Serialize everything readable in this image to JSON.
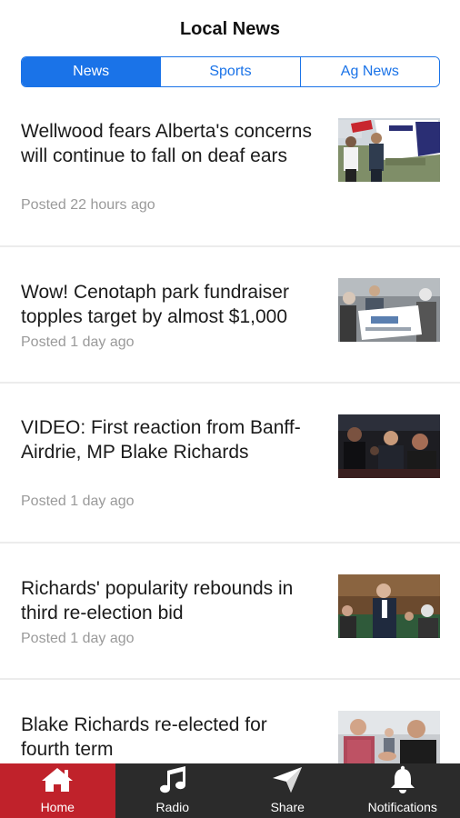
{
  "header": {
    "title": "Local News"
  },
  "tabs": [
    {
      "label": "News",
      "active": true
    },
    {
      "label": "Sports",
      "active": false
    },
    {
      "label": "Ag News",
      "active": false
    }
  ],
  "articles": [
    {
      "title": "Wellwood fears Alberta's concerns will continue to fall on deaf ears",
      "meta": "Posted 22 hours ago"
    },
    {
      "title": "Wow! Cenotaph park fundraiser topples target by almost $1,000",
      "meta": "Posted 1 day ago"
    },
    {
      "title": "VIDEO: First reaction from Banff- Airdrie, MP Blake Richards",
      "meta": "Posted 1 day ago"
    },
    {
      "title": "Richards' popularity rebounds in third re-election bid",
      "meta": "Posted 1 day ago"
    },
    {
      "title": "Blake Richards re-elected for fourth term",
      "meta": ""
    }
  ],
  "tabbar": [
    {
      "label": "Home",
      "icon": "home-icon",
      "active": true
    },
    {
      "label": "Radio",
      "icon": "music-note-icon",
      "active": false
    },
    {
      "label": "Share",
      "icon": "paper-plane-icon",
      "active": false
    },
    {
      "label": "Notifications",
      "icon": "bell-icon",
      "active": false
    }
  ],
  "colors": {
    "accent": "#1a73e8",
    "tabbar_bg": "#2b2b2b",
    "tabbar_active": "#c0222b",
    "meta": "#9a9a9a"
  }
}
